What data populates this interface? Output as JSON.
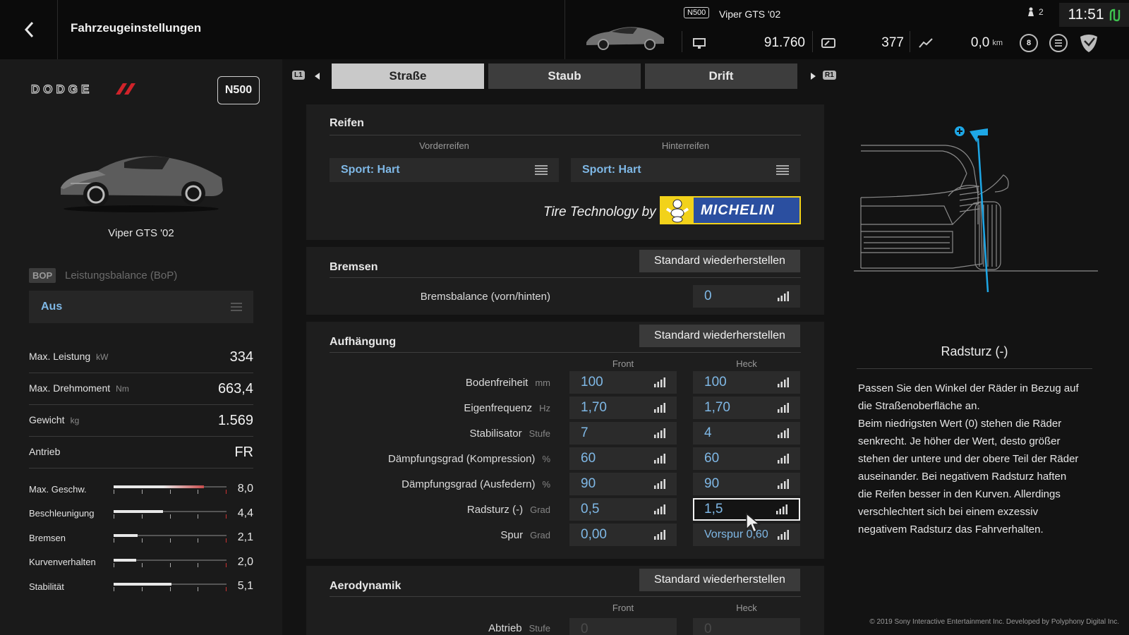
{
  "header": {
    "title": "Fahrzeugeinstellungen",
    "car_class_badge": "N500",
    "car_name": "Viper GTS '02",
    "credits": "91.760",
    "mileage_points": "377",
    "distance": "0,0",
    "distance_unit": "km",
    "player_count": "2",
    "time": "11:51",
    "level": "8"
  },
  "left": {
    "brand": "DODGE",
    "class_badge": "N500",
    "car_name": "Viper GTS '02",
    "bop_tag": "BOP",
    "bop_label": "Leistungsbalance (BoP)",
    "bop_value": "Aus",
    "specs": [
      {
        "label": "Max. Leistung",
        "unit": "kW",
        "value": "334"
      },
      {
        "label": "Max. Drehmoment",
        "unit": "Nm",
        "value": "663,4"
      },
      {
        "label": "Gewicht",
        "unit": "kg",
        "value": "1.569"
      },
      {
        "label": "Antrieb",
        "unit": "",
        "value": "FR"
      }
    ],
    "performance": [
      {
        "label": "Max. Geschw.",
        "value": "8,0",
        "level": 0.8,
        "accent": "#c94b4b"
      },
      {
        "label": "Beschleunigung",
        "value": "4,4",
        "level": 0.44,
        "accent": ""
      },
      {
        "label": "Bremsen",
        "value": "2,1",
        "level": 0.21,
        "accent": ""
      },
      {
        "label": "Kurvenverhalten",
        "value": "2,0",
        "level": 0.2,
        "accent": ""
      },
      {
        "label": "Stabilität",
        "value": "5,1",
        "level": 0.51,
        "accent": ""
      }
    ]
  },
  "tabs": {
    "left_button": "L1",
    "right_button": "R1",
    "items": [
      "Straße",
      "Staub",
      "Drift"
    ],
    "active": 0
  },
  "tires": {
    "title": "Reifen",
    "front_label": "Vorderreifen",
    "rear_label": "Hinterreifen",
    "front_value": "Sport: Hart",
    "rear_value": "Sport: Hart",
    "tech_text": "Tire Technology by",
    "brand": "MICHELIN"
  },
  "brakes": {
    "title": "Bremsen",
    "reset_label": "Standard wiederherstellen",
    "balance_label": "Bremsbalance (vorn/hinten)",
    "balance_value": "0"
  },
  "suspension": {
    "title": "Aufhängung",
    "reset_label": "Standard wiederherstellen",
    "col_front": "Front",
    "col_rear": "Heck",
    "rows": [
      {
        "label": "Bodenfreiheit",
        "unit": "mm",
        "front": "100",
        "rear": "100"
      },
      {
        "label": "Eigenfrequenz",
        "unit": "Hz",
        "front": "1,70",
        "rear": "1,70"
      },
      {
        "label": "Stabilisator",
        "unit": "Stufe",
        "front": "7",
        "rear": "4"
      },
      {
        "label": "Dämpfungsgrad (Kompression)",
        "unit": "%",
        "front": "60",
        "rear": "60"
      },
      {
        "label": "Dämpfungsgrad (Ausfedern)",
        "unit": "%",
        "front": "90",
        "rear": "90"
      },
      {
        "label": "Radsturz (-)",
        "unit": "Grad",
        "front": "0,5",
        "rear": "1,5"
      },
      {
        "label": "Spur",
        "unit": "Grad",
        "front": "0,00",
        "rear": "Vorspur 0,60"
      }
    ]
  },
  "aero": {
    "title": "Aerodynamik",
    "reset_label": "Standard wiederherstellen",
    "col_front": "Front",
    "col_rear": "Heck",
    "row_label": "Abtrieb",
    "row_unit": "Stufe",
    "front": "0",
    "rear": "0"
  },
  "help": {
    "title": "Radsturz (-)",
    "text": "Passen Sie den Winkel der Räder in Bezug auf\ndie Straßenoberfläche an.\nBeim niedrigsten Wert (0) stehen die Räder\nsenkrecht. Je höher der Wert, desto größer\nstehen der untere und der obere Teil der Räder\nauseinander. Bei negativem Radsturz haften\ndie Reifen besser in den Kurven. Allerdings\nverschlechtert sich bei einem exzessiv\nnegativem Radsturz das Fahrverhalten."
  },
  "footer": {
    "copyright": "© 2019 Sony Interactive Entertainment Inc. Developed by Polyphony Digital Inc."
  },
  "colors": {
    "accent_blue": "#7fb8e6",
    "diagram_cyan": "#1ea7e6",
    "time_green": "#3ec24f"
  },
  "icons": {
    "back": "chevron-left-icon",
    "menu": "list-icon",
    "bars": "signal-bars-icon"
  }
}
